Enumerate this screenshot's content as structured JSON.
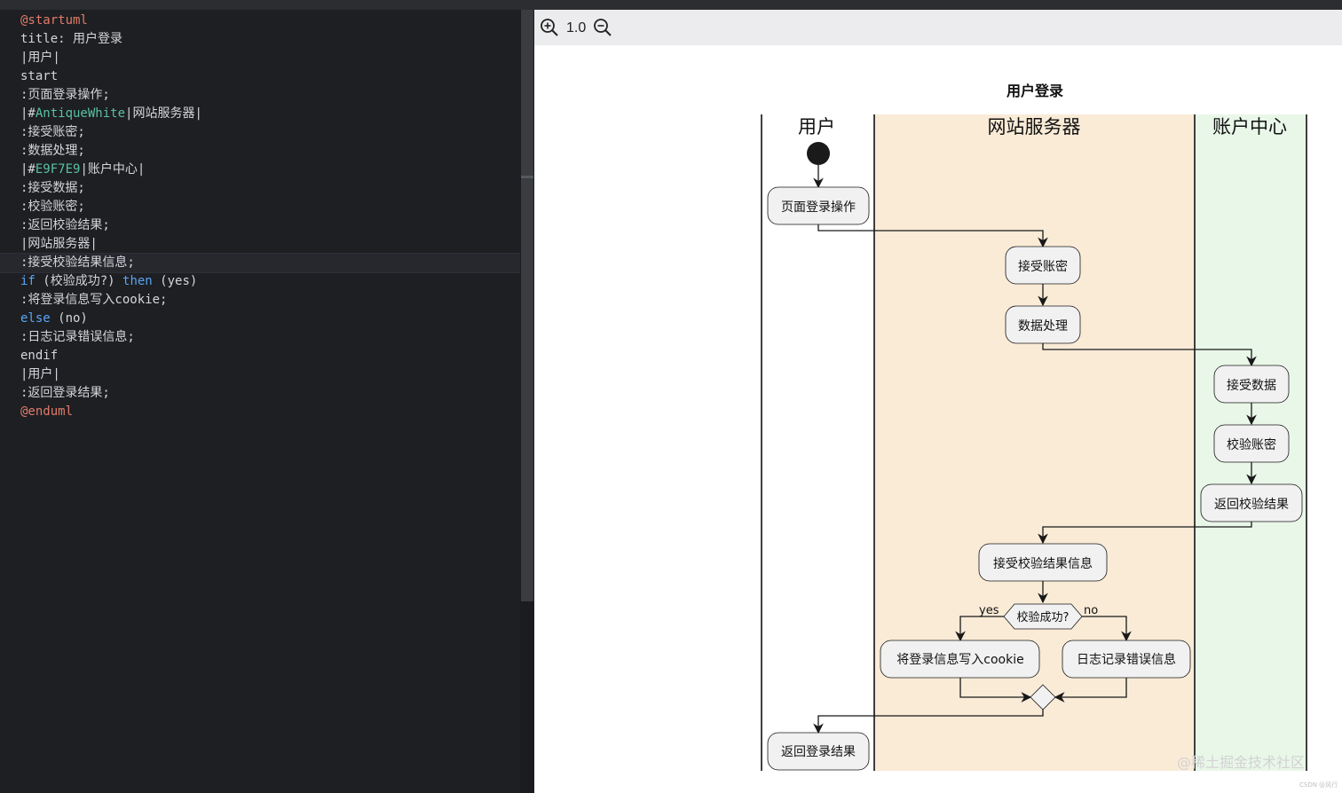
{
  "editor": {
    "lines": [
      {
        "segments": [
          {
            "t": "@startuml",
            "c": "dir"
          }
        ]
      },
      {
        "segments": [
          {
            "t": "title: 用户登录",
            "c": ""
          }
        ]
      },
      {
        "segments": [
          {
            "t": "|用户|",
            "c": ""
          }
        ]
      },
      {
        "segments": [
          {
            "t": "start",
            "c": ""
          }
        ]
      },
      {
        "segments": [
          {
            "t": ":页面登录操作;",
            "c": ""
          }
        ]
      },
      {
        "segments": [
          {
            "t": "|#",
            "c": ""
          },
          {
            "t": "AntiqueWhite",
            "c": "col"
          },
          {
            "t": "|网站服务器|",
            "c": ""
          }
        ]
      },
      {
        "segments": [
          {
            "t": ":接受账密;",
            "c": ""
          }
        ]
      },
      {
        "segments": [
          {
            "t": ":数据处理;",
            "c": ""
          }
        ]
      },
      {
        "segments": [
          {
            "t": "|#",
            "c": ""
          },
          {
            "t": "E9F7E9",
            "c": "col"
          },
          {
            "t": "|账户中心|",
            "c": ""
          }
        ]
      },
      {
        "segments": [
          {
            "t": ":接受数据;",
            "c": ""
          }
        ]
      },
      {
        "segments": [
          {
            "t": ":校验账密;",
            "c": ""
          }
        ]
      },
      {
        "segments": [
          {
            "t": ":返回校验结果;",
            "c": ""
          }
        ]
      },
      {
        "segments": [
          {
            "t": "|网站服务器|",
            "c": ""
          }
        ]
      },
      {
        "segments": [
          {
            "t": ":接受校验结果信息;",
            "c": ""
          }
        ]
      },
      {
        "segments": [
          {
            "t": "if",
            "c": "kw"
          },
          {
            "t": " (校验成功?) ",
            "c": ""
          },
          {
            "t": "then",
            "c": "kw"
          },
          {
            "t": " (yes)",
            "c": ""
          }
        ]
      },
      {
        "segments": [
          {
            "t": ":将登录信息写入cookie;",
            "c": ""
          }
        ]
      },
      {
        "segments": [
          {
            "t": "else",
            "c": "kw"
          },
          {
            "t": " (no)",
            "c": ""
          }
        ]
      },
      {
        "segments": [
          {
            "t": ":日志记录错误信息;",
            "c": ""
          }
        ]
      },
      {
        "segments": [
          {
            "t": "endif",
            "c": ""
          }
        ]
      },
      {
        "segments": [
          {
            "t": "|用户|",
            "c": ""
          }
        ]
      },
      {
        "segments": [
          {
            "t": ":返回登录结果;",
            "c": ""
          }
        ]
      },
      {
        "segments": [
          {
            "t": "@enduml",
            "c": "dir"
          }
        ]
      }
    ]
  },
  "preview": {
    "zoom_level": "1.0",
    "zoom_in_icon": "zoom-in-icon",
    "zoom_out_icon": "zoom-out-icon"
  },
  "diagram": {
    "title": "用户登录",
    "lanes": [
      {
        "label": "用户",
        "color": "#ffffff"
      },
      {
        "label": "网站服务器",
        "color": "#faebd7"
      },
      {
        "label": "账户中心",
        "color": "#e9f7e9"
      }
    ],
    "activities": {
      "page_login": "页面登录操作",
      "receive_credentials": "接受账密",
      "process_data": "数据处理",
      "receive_data": "接受数据",
      "verify_credentials": "校验账密",
      "return_result": "返回校验结果",
      "receive_result_info": "接受校验结果信息",
      "write_cookie": "将登录信息写入cookie",
      "log_error": "日志记录错误信息",
      "return_login_result": "返回登录结果"
    },
    "decision": {
      "label": "校验成功?",
      "yes": "yes",
      "no": "no"
    }
  },
  "watermark": {
    "text": "@稀土掘金技术社区",
    "sub": "CSDN @风行"
  },
  "colors": {
    "editor_bg": "#1e1f22",
    "directive": "#e07b6a",
    "keyword": "#5aa4f5",
    "color_token": "#58c1a2"
  }
}
